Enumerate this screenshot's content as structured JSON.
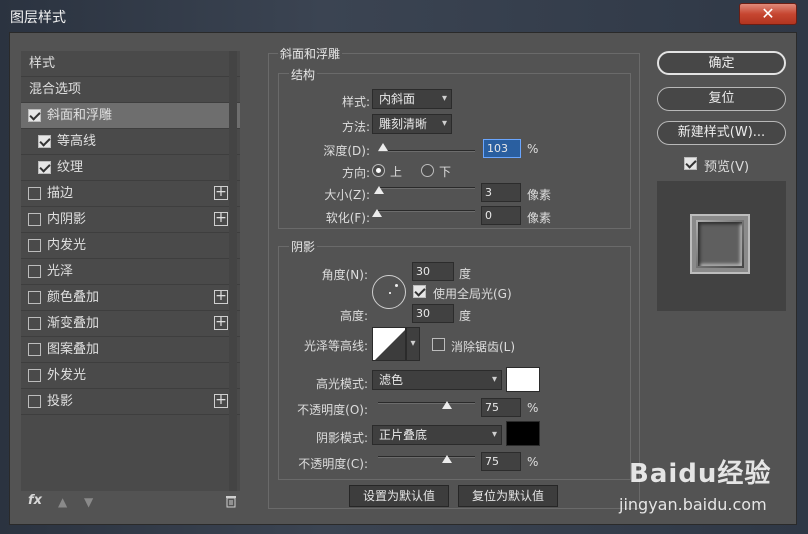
{
  "window": {
    "title": "图层样式",
    "close": "✕"
  },
  "left": {
    "header": "样式",
    "blend": "混合选项",
    "items": [
      {
        "label": "斜面和浮雕",
        "checked": true,
        "selected": true
      },
      {
        "label": "等高线",
        "checked": true,
        "sub": true
      },
      {
        "label": "纹理",
        "checked": true,
        "sub": true
      },
      {
        "label": "描边",
        "checked": false,
        "plus": true
      },
      {
        "label": "内阴影",
        "checked": false,
        "plus": true
      },
      {
        "label": "内发光",
        "checked": false
      },
      {
        "label": "光泽",
        "checked": false
      },
      {
        "label": "颜色叠加",
        "checked": false,
        "plus": true
      },
      {
        "label": "渐变叠加",
        "checked": false,
        "plus": true
      },
      {
        "label": "图案叠加",
        "checked": false
      },
      {
        "label": "外发光",
        "checked": false
      },
      {
        "label": "投影",
        "checked": false,
        "plus": true
      }
    ],
    "fx": "fx",
    "plus_symbol": "+"
  },
  "bevel": {
    "title": "斜面和浮雕",
    "structure": {
      "title": "结构",
      "style_label": "样式:",
      "style_value": "内斜面",
      "technique_label": "方法:",
      "technique_value": "雕刻清晰",
      "depth_label": "深度(D):",
      "depth_value": "103",
      "depth_unit": "%",
      "direction_label": "方向:",
      "dir_up": "上",
      "dir_down": "下",
      "size_label": "大小(Z):",
      "size_value": "3",
      "size_unit": "像素",
      "soften_label": "软化(F):",
      "soften_value": "0",
      "soften_unit": "像素"
    },
    "shading": {
      "title": "阴影",
      "angle_label": "角度(N):",
      "angle_value": "30",
      "angle_unit": "度",
      "global_light": "使用全局光(G)",
      "altitude_label": "高度:",
      "altitude_value": "30",
      "altitude_unit": "度",
      "gloss_label": "光泽等高线:",
      "antialias": "消除锯齿(L)",
      "highlight_label": "高光模式:",
      "highlight_value": "滤色",
      "highlight_color": "#ffffff",
      "hl_opacity_label": "不透明度(O):",
      "hl_opacity_value": "75",
      "hl_opacity_unit": "%",
      "shadow_label": "阴影模式:",
      "shadow_value": "正片叠底",
      "shadow_color": "#000000",
      "sh_opacity_label": "不透明度(C):",
      "sh_opacity_value": "75",
      "sh_opacity_unit": "%"
    },
    "make_default": "设置为默认值",
    "reset_default": "复位为默认值"
  },
  "right": {
    "ok": "确定",
    "reset": "复位",
    "new_style": "新建样式(W)...",
    "preview": "预览(V)"
  },
  "watermark": {
    "brand": "Baidu经验",
    "url": "jingyan.baidu.com"
  }
}
